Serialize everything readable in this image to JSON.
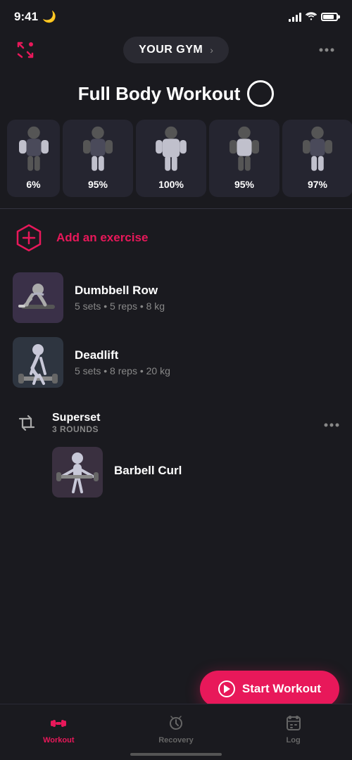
{
  "statusBar": {
    "time": "9:41",
    "battery": "85"
  },
  "header": {
    "gymLabel": "YOUR GYM",
    "chevron": "›",
    "moreDots": "···"
  },
  "workoutTitle": "Full Body Workout",
  "muscleGroups": [
    {
      "id": "mg1",
      "pct": "6%"
    },
    {
      "id": "mg2",
      "pct": "95%"
    },
    {
      "id": "mg3",
      "pct": "100%"
    },
    {
      "id": "mg4",
      "pct": "95%"
    },
    {
      "id": "mg5",
      "pct": "97%"
    }
  ],
  "addExercise": {
    "label": "Add an exercise"
  },
  "exercises": [
    {
      "name": "Dumbbell Row",
      "details": "5 sets • 5 reps • 8 kg",
      "bgColor": "#3a3240"
    },
    {
      "name": "Deadlift",
      "details": "5 sets • 8 reps • 20 kg",
      "bgColor": "#2e3540"
    }
  ],
  "superset": {
    "label": "Superset",
    "rounds": "3 ROUNDS",
    "exercise": {
      "name": "Barbell Curl",
      "bgColor": "#3a3040"
    }
  },
  "startWorkout": {
    "label": "Start Workout"
  },
  "bottomNav": [
    {
      "id": "workout",
      "label": "Workout",
      "active": true
    },
    {
      "id": "recovery",
      "label": "Recovery",
      "active": false
    },
    {
      "id": "log",
      "label": "Log",
      "active": false
    }
  ]
}
